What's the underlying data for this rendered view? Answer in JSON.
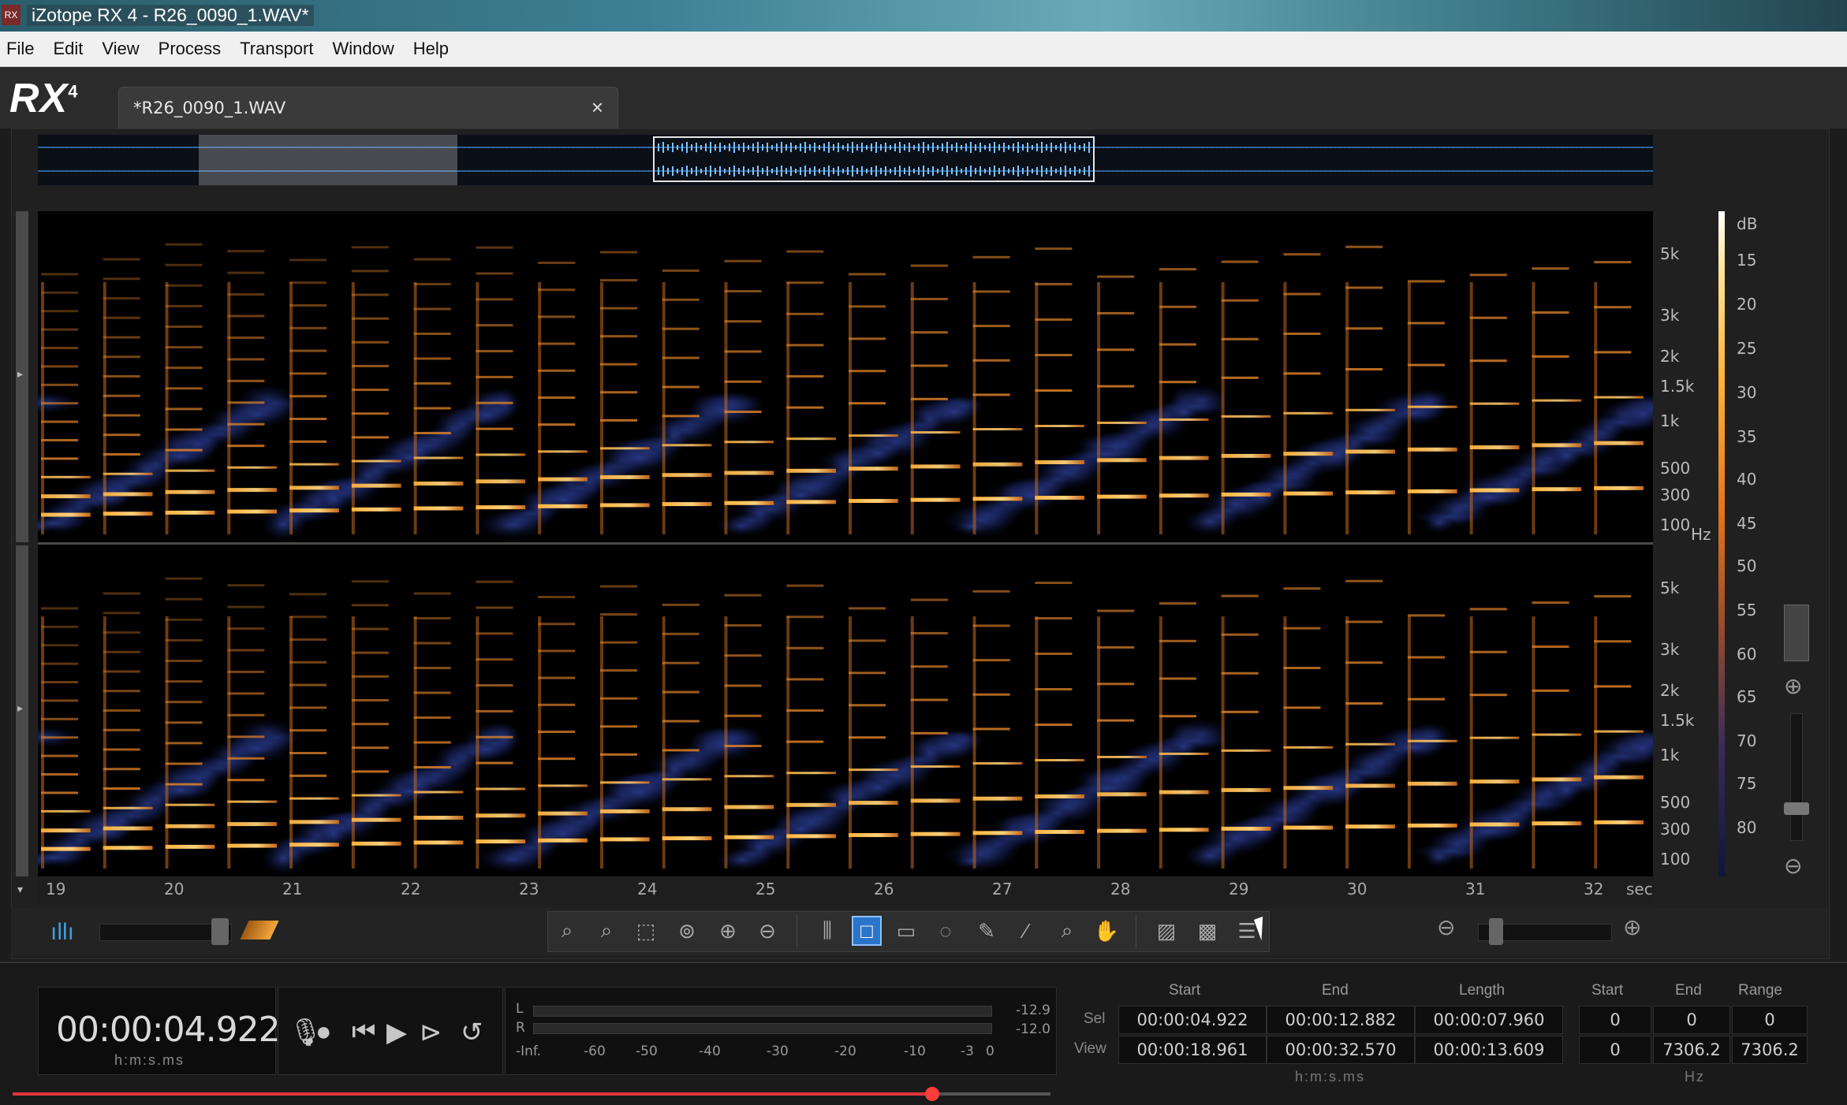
{
  "window": {
    "title": "iZotope RX 4 - R26_0090_1.WAV*",
    "app_icon": "rx"
  },
  "menu": [
    "File",
    "Edit",
    "View",
    "Process",
    "Transport",
    "Window",
    "Help"
  ],
  "logo": {
    "text": "RX",
    "version": "4"
  },
  "tab": {
    "label": "*R26_0090_1.WAV",
    "close": "×"
  },
  "frequency_labels": [
    "5k",
    "3k",
    "2k",
    "1.5k",
    "1k",
    "500",
    "300",
    "100"
  ],
  "frequency_unit": "Hz",
  "db_scale": {
    "unit": "dB",
    "labels": [
      "15",
      "20",
      "25",
      "30",
      "35",
      "40",
      "45",
      "50",
      "55",
      "60",
      "65",
      "70",
      "75",
      "80"
    ]
  },
  "time_ruler": {
    "labels": [
      "19",
      "20",
      "21",
      "22",
      "23",
      "24",
      "25",
      "26",
      "27",
      "28",
      "29",
      "30",
      "31",
      "32"
    ],
    "unit": "sec"
  },
  "toolbar": {
    "tools": [
      "zoom-in-time-icon",
      "zoom-out-time-icon",
      "zoom-selection-icon",
      "zoom-all-icon",
      "zoom-in-freq-icon",
      "zoom-out-freq-icon",
      "time-select-icon",
      "time-freq-select-icon",
      "freq-select-icon",
      "lasso-icon",
      "brush-icon",
      "magic-wand-icon",
      "find-similar-icon",
      "hand-icon",
      "spectrum-1-icon",
      "spectrum-2-icon",
      "menu-icon"
    ],
    "active_tool": "time-freq-select-icon"
  },
  "transport": {
    "time": "00:00:04.922",
    "time_unit": "h:m:s.ms"
  },
  "meter": {
    "L_label": "L",
    "R_label": "R",
    "L_peak": "-12.9",
    "R_peak": "-12.0",
    "scale": [
      "-Inf.",
      "-60",
      "-50",
      "-40",
      "-30",
      "-20",
      "-10",
      "-3",
      "0"
    ]
  },
  "info": {
    "headers": [
      "Start",
      "End",
      "Length"
    ],
    "rows": [
      {
        "label": "Sel",
        "start": "00:00:04.922",
        "end": "00:00:12.882",
        "length": "00:00:07.960"
      },
      {
        "label": "View",
        "start": "00:00:18.961",
        "end": "00:00:32.570",
        "length": "00:00:13.609"
      }
    ],
    "time_unit": "h:m:s.ms",
    "freq_headers": [
      "Start",
      "End",
      "Range"
    ],
    "freq_rows": [
      {
        "start": "0",
        "end": "0",
        "range": "0"
      },
      {
        "start": "0",
        "end": "7306.2",
        "range": "7306.2"
      }
    ],
    "freq_unit": "Hz"
  },
  "playback_progress": 0.886
}
